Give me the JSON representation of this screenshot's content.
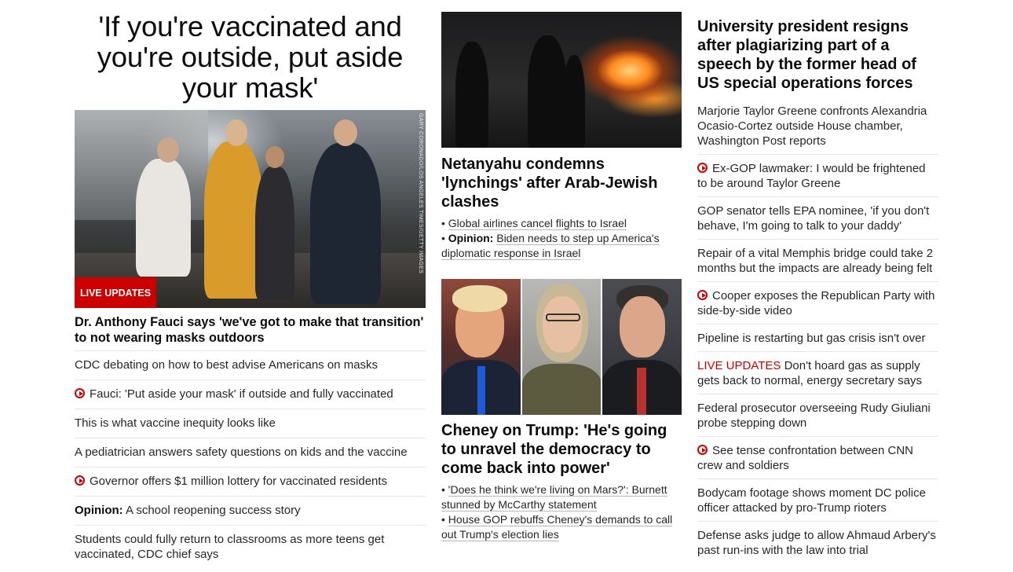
{
  "col1": {
    "banner": "'If you're vaccinated and you're outside, put aside your mask'",
    "photo_credit": "GARY CORONADO/LOS ANGELES TIMES/GETTY IMAGES",
    "live_tag": "LIVE UPDATES",
    "headline": "Dr. Anthony Fauci says 'we've got to make that transition' to not wearing masks outdoors",
    "items": [
      {
        "text": "CDC debating on how to best advise Americans on masks",
        "video": false
      },
      {
        "text": "Fauci: 'Put aside your mask' if outside and fully vaccinated",
        "video": true
      },
      {
        "text": "This is what vaccine inequity looks like",
        "video": false
      },
      {
        "text": "A pediatrician answers safety questions on kids and the vaccine",
        "video": false
      },
      {
        "text": "Governor offers $1 million lottery for vaccinated residents",
        "video": true
      },
      {
        "prefix": "Opinion:",
        "text": "A school reopening success story",
        "video": false
      },
      {
        "text": "Students could fully return to classrooms as more teens get vaccinated, CDC chief says",
        "video": false
      }
    ]
  },
  "col2": {
    "story1": {
      "headline": "Netanyahu condemns 'lynchings' after Arab-Jewish clashes",
      "sub1": "Global airlines cancel flights to Israel",
      "sub2_prefix": "Opinion:",
      "sub2": "Biden needs to step up America's diplomatic response in Israel"
    },
    "story2": {
      "headline": "Cheney on Trump: 'He's going to unravel the democracy to come back into power'",
      "sub1": "'Does he think we're living on Mars?': Burnett stunned by McCarthy statement",
      "sub2": "House GOP rebuffs Cheney's demands to call out Trump's election lies"
    }
  },
  "col3": {
    "headline": "University president resigns after plagiarizing part of a speech by the former head of US special operations forces",
    "items": [
      {
        "text": "Marjorie Taylor Greene confronts Alexandria Ocasio-Cortez outside House chamber, Washington Post reports",
        "video": false
      },
      {
        "text": "Ex-GOP lawmaker: I would be frightened to be around Taylor Greene",
        "video": true
      },
      {
        "text": "GOP senator tells EPA nominee, 'if you don't behave, I'm going to talk to your daddy'",
        "video": false
      },
      {
        "text": "Repair of a vital Memphis bridge could take 2 months but the impacts are already being felt",
        "video": false
      },
      {
        "text": "Cooper exposes the Republican Party with side-by-side video",
        "video": true
      },
      {
        "text": "Pipeline is restarting but gas crisis isn't over",
        "video": false
      },
      {
        "live": "LIVE UPDATES",
        "text": "Don't hoard gas as supply gets back to normal, energy secretary says",
        "video": false
      },
      {
        "text": "Federal prosecutor overseeing Rudy Giuliani probe stepping down",
        "video": false
      },
      {
        "text": "See tense confrontation between CNN crew and soldiers",
        "video": true
      },
      {
        "text": "Bodycam footage shows moment DC police officer attacked by pro-Trump rioters",
        "video": false
      },
      {
        "text": "Defense asks judge to allow Ahmaud Arbery's past run-ins with the law into trial",
        "video": false
      }
    ]
  }
}
